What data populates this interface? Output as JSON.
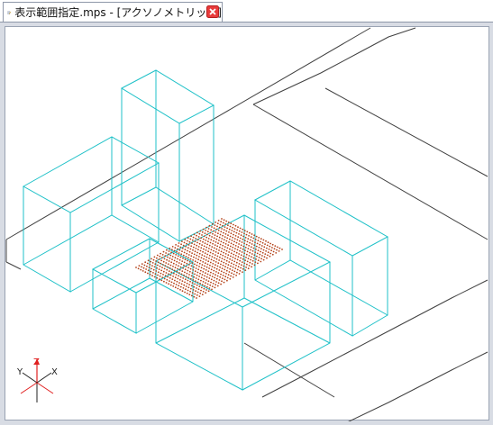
{
  "tab": {
    "title": "表示範囲指定.mps - [アクソノメトリック]",
    "icon": "document-pen-icon",
    "close_icon": "close-icon",
    "close_color": "#e83b3b"
  },
  "view": {
    "mode": "アクソノメトリック",
    "box_color": "#1fc1c8",
    "grid_color": "#404040",
    "point_color": "#b4431a"
  },
  "axes": {
    "x_label": "X",
    "y_label": "Y",
    "z_label": "Z"
  }
}
